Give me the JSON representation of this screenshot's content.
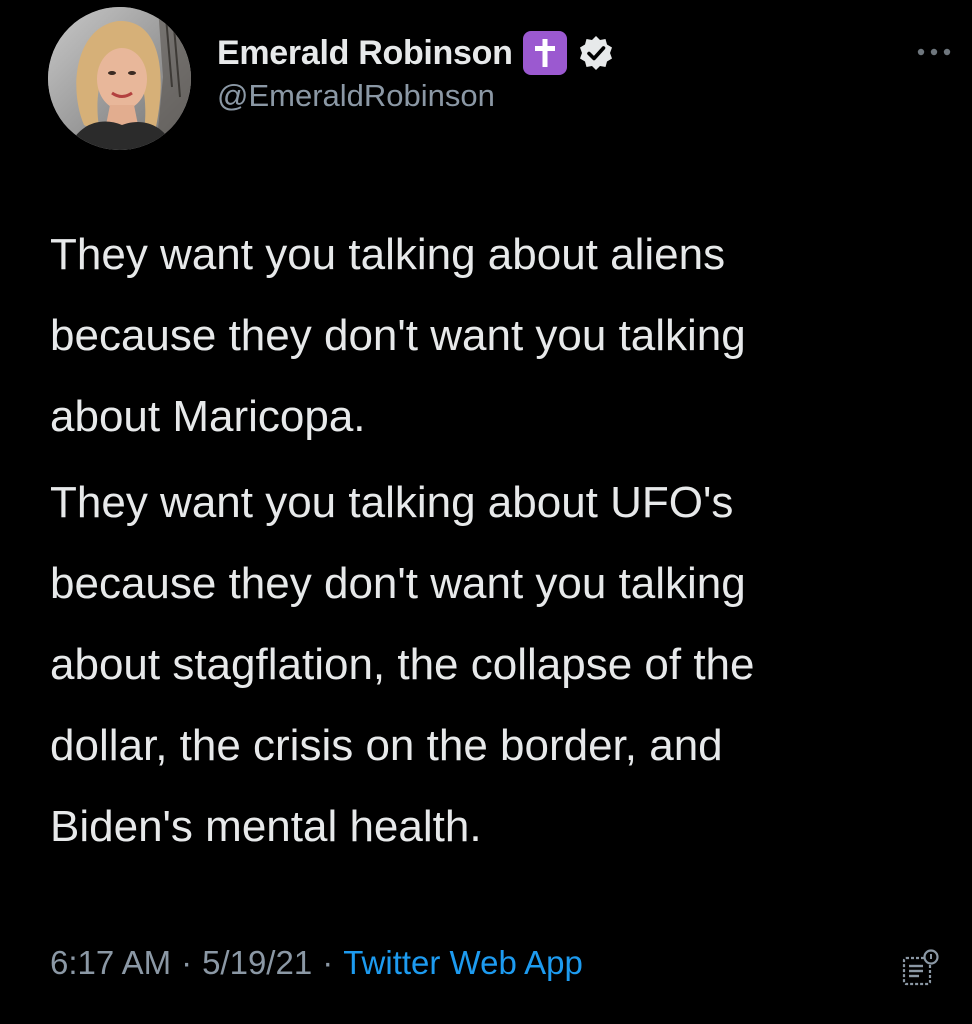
{
  "author": {
    "display_name": "Emerald Robinson",
    "handle": "@EmeraldRobinson",
    "avatar_icon": "profile-photo",
    "badges": [
      "latin-cross-icon",
      "verified-check-icon"
    ],
    "badge_color": "#9b59d0"
  },
  "tweet": {
    "paragraphs": [
      "They want you talking about aliens\nbecause they don't want you talking\nabout Maricopa.",
      "They want you talking about UFO's\nbecause they don't want you talking\nabout stagflation, the collapse of the\ndollar, the crisis on the border, and\nBiden's mental health."
    ]
  },
  "meta": {
    "time": "6:17 AM",
    "separator": "·",
    "date": "5/19/21",
    "source": "Twitter Web App",
    "link_color": "#1d9bf0"
  },
  "icons": {
    "more": "more-horizontal-icon",
    "analytics": "view-tweet-analytics-icon"
  }
}
